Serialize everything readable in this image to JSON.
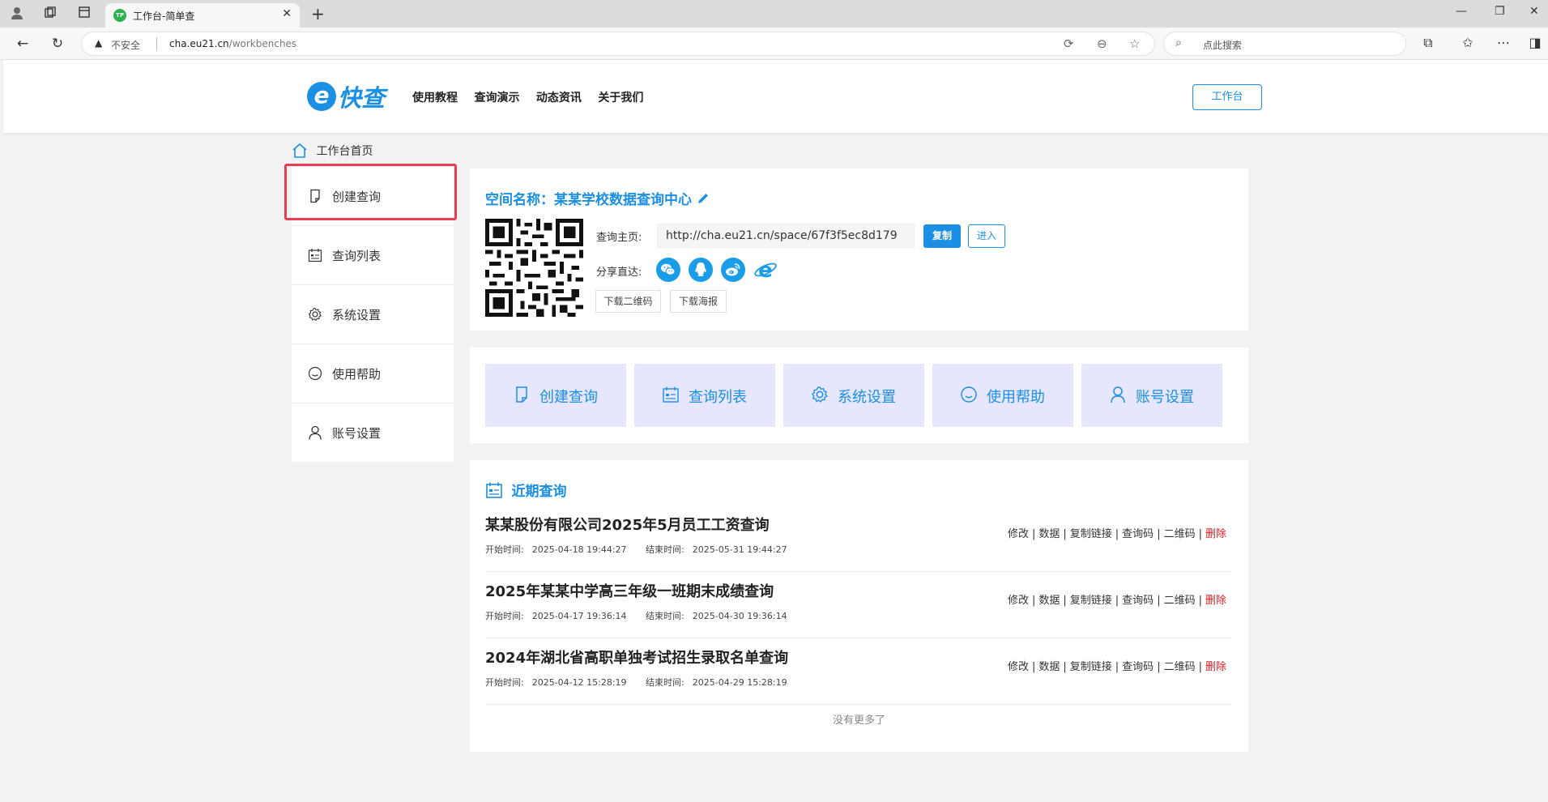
{
  "browser": {
    "tab_title": "工作台-简单查",
    "favicon_text": "TP",
    "address": {
      "insecure_label": "不安全",
      "host": "cha.eu21.cn",
      "path": "/workbenches"
    },
    "search_placeholder": "点此搜索"
  },
  "header": {
    "logo_text": "快查",
    "logo_letter": "e",
    "nav": [
      "使用教程",
      "查询演示",
      "动态资讯",
      "关于我们"
    ],
    "workbench_button": "工作台"
  },
  "breadcrumb": {
    "label": "工作台首页"
  },
  "sidebar": {
    "items": [
      {
        "label": "创建查询",
        "icon": "document-icon"
      },
      {
        "label": "查询列表",
        "icon": "list-icon"
      },
      {
        "label": "系统设置",
        "icon": "gear-icon"
      },
      {
        "label": "使用帮助",
        "icon": "smile-icon"
      },
      {
        "label": "账号设置",
        "icon": "user-icon"
      }
    ],
    "highlighted_index": 0
  },
  "space": {
    "title": "空间名称：某某学校数据查询中心",
    "home_label": "查询主页:",
    "home_url": "http://cha.eu21.cn/space/67f3f5ec8d179",
    "copy_button": "复制",
    "enter_button": "进入",
    "share_label": "分享直达:",
    "share_icons": [
      "wechat-icon",
      "qq-icon",
      "weibo-icon",
      "ie-icon"
    ],
    "download_qr_button": "下载二维码",
    "download_poster_button": "下载海报"
  },
  "quick_tiles": [
    {
      "label": "创建查询",
      "icon": "document-icon"
    },
    {
      "label": "查询列表",
      "icon": "list-icon"
    },
    {
      "label": "系统设置",
      "icon": "gear-icon"
    },
    {
      "label": "使用帮助",
      "icon": "smile-icon"
    },
    {
      "label": "账号设置",
      "icon": "user-icon"
    }
  ],
  "recent": {
    "heading": "近期查询",
    "start_label": "开始时间:",
    "end_label": "结束时间:",
    "actions": [
      "修改",
      "数据",
      "复制链接",
      "查询码",
      "二维码",
      "删除"
    ],
    "items": [
      {
        "title": "某某股份有限公司2025年5月员工工资查询",
        "start": "2025-04-18 19:44:27",
        "end": "2025-05-31 19:44:27"
      },
      {
        "title": "2025年某某中学高三年级一班期末成绩查询",
        "start": "2025-04-17 19:36:14",
        "end": "2025-04-30 19:36:14"
      },
      {
        "title": "2024年湖北省高职单独考试招生录取名单查询",
        "start": "2025-04-12 15:28:19",
        "end": "2025-04-29 15:28:19"
      }
    ],
    "no_more": "没有更多了"
  },
  "colors": {
    "accent": "#1a8fe3",
    "tile_bg": "#e6e6ff",
    "danger": "#e52222",
    "highlight": "#e63e54"
  }
}
